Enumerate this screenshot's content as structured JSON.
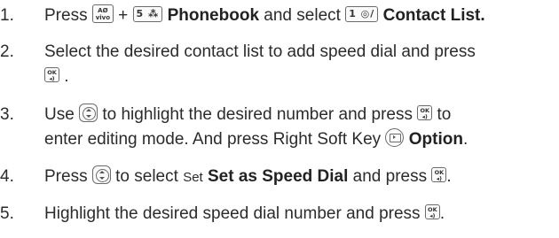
{
  "steps": [
    {
      "number": "1.",
      "press": "Press",
      "plus": "+",
      "mute_key": "AØ\nvivo",
      "five_key": "5 ⁂",
      "phonebook": "Phonebook",
      "and_select": "and select",
      "one_key": "1 ◎/",
      "contact_list": "Contact List."
    },
    {
      "number": "2.",
      "line1": "Select the desired contact list to add speed dial and press",
      "ok_key": "OK",
      "end": "."
    },
    {
      "number": "3.",
      "use": "Use",
      "middle": "to highlight the desired number and press",
      "to": "to",
      "line2_a": "enter editing mode. And press Right Soft Key",
      "option": "Option",
      "end": "."
    },
    {
      "number": "4.",
      "press": "Press",
      "to_select": "to select",
      "set_small": "Set",
      "set_speed": "Set as Speed Dial",
      "and_press": "and press",
      "end": "."
    },
    {
      "number": "5.",
      "text": "Highlight the desired speed dial number and press",
      "end": "."
    }
  ],
  "icons": {
    "mute": "mute-vivo-key-icon",
    "five": "number-5-key-icon",
    "one": "number-1-key-icon",
    "ok": "ok-key-icon",
    "nav": "up-down-navigation-key-icon",
    "soft": "right-soft-key-icon"
  }
}
